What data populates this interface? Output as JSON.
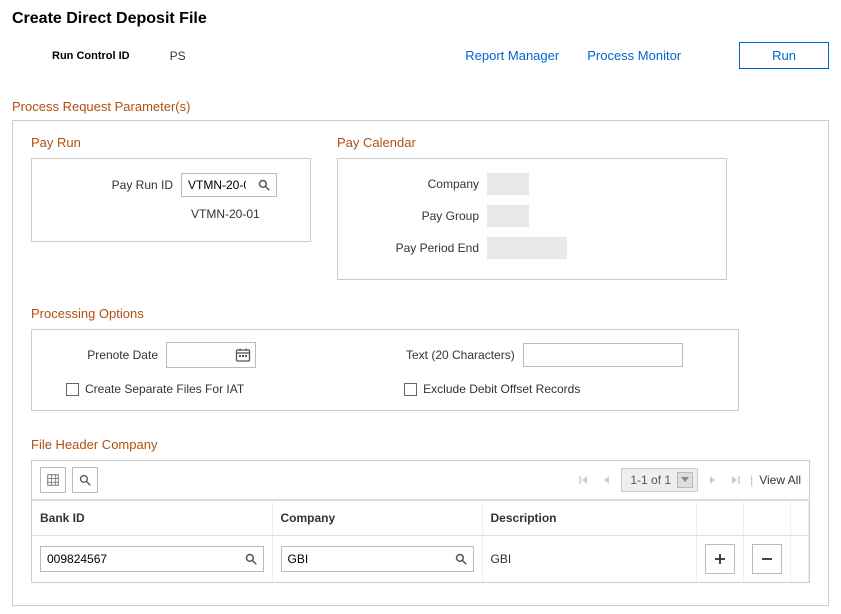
{
  "page_title": "Create Direct Deposit File",
  "run_control": {
    "label": "Run Control ID",
    "value": "PS"
  },
  "links": {
    "report_manager": "Report Manager",
    "process_monitor": "Process Monitor",
    "run_button": "Run"
  },
  "params_title": "Process Request Parameter(s)",
  "pay_run": {
    "title": "Pay Run",
    "id_label": "Pay Run ID",
    "id_value": "VTMN-20-01",
    "desc": "VTMN-20-01"
  },
  "pay_calendar": {
    "title": "Pay Calendar",
    "company_label": "Company",
    "paygroup_label": "Pay Group",
    "period_end_label": "Pay Period End"
  },
  "proc_opts": {
    "title": "Processing Options",
    "prenote_label": "Prenote Date",
    "text_label": "Text (20 Characters)",
    "separate_files_label": "Create Separate Files For IAT",
    "exclude_debit_label": "Exclude Debit Offset Records"
  },
  "file_header": {
    "title": "File Header Company",
    "paging": "1-1 of 1",
    "view_all": "View All",
    "cols": {
      "bank_id": "Bank ID",
      "company": "Company",
      "description": "Description"
    },
    "row": {
      "bank_id": "009824567",
      "company": "GBI",
      "description": "GBI"
    }
  }
}
